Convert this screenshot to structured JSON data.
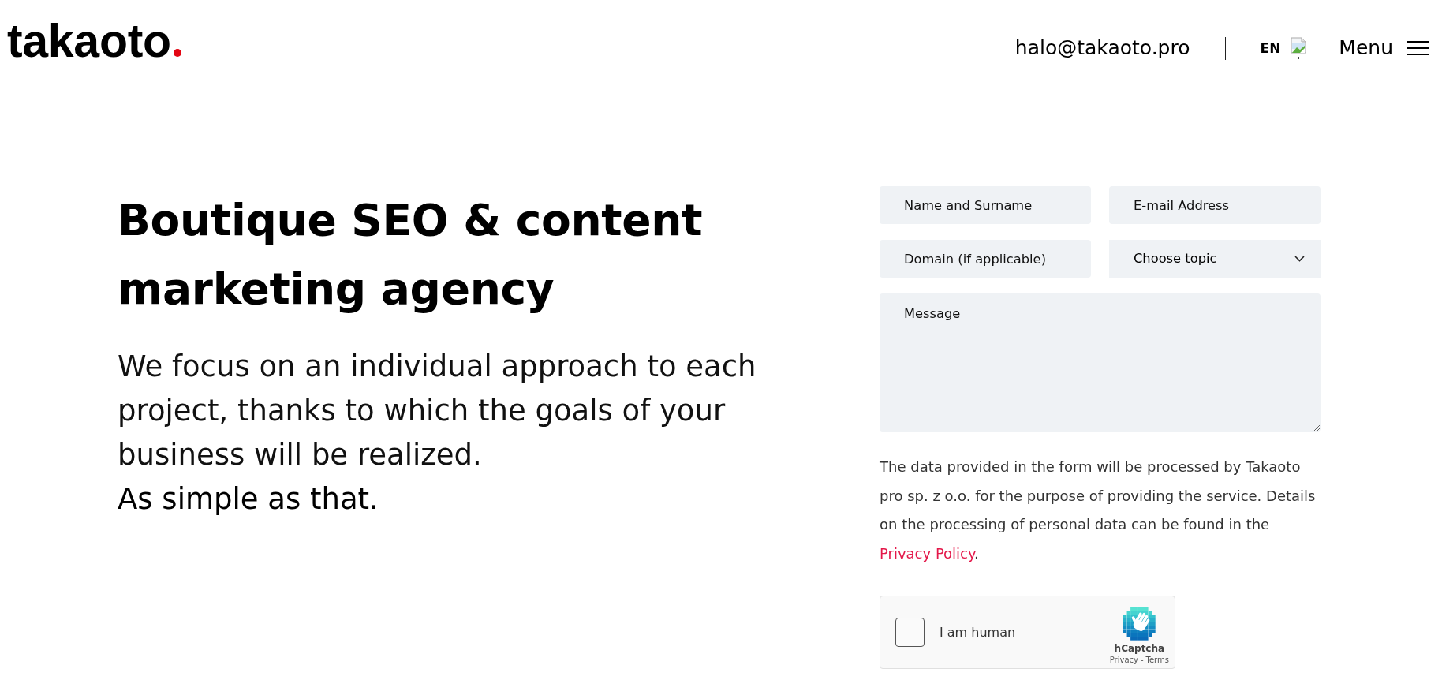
{
  "header": {
    "logo": {
      "text": "takaoto"
    },
    "email": "halo@takaoto.pro",
    "language": "EN",
    "menu": "Menu"
  },
  "hero": {
    "title": "Boutique SEO & content marketing agency",
    "intro": "We focus on an individual approach to each project, thanks to which the goals of your business will be realized.",
    "tagline": "As simple as that."
  },
  "form": {
    "fields": [
      {
        "kind": "input",
        "placeholder": "Name and Surname"
      },
      {
        "kind": "input",
        "placeholder": "E-mail Address"
      },
      {
        "kind": "input",
        "placeholder": "Domain (if applicable)"
      },
      {
        "kind": "select",
        "value": "Choose topic"
      },
      {
        "kind": "textarea",
        "placeholder": "Message"
      }
    ],
    "notice": {
      "text": "The data provided in the form will be processed by Takaoto pro sp. z o.o. for the purpose of providing the service. Details on the processing of personal data can be found in the",
      "link": "Privacy Policy",
      "end": "."
    },
    "captcha": {
      "checked": false,
      "label": "I am human",
      "brand": "hCaptcha",
      "privacy": "Privacy",
      "separator": "-",
      "terms": "Terms"
    }
  }
}
